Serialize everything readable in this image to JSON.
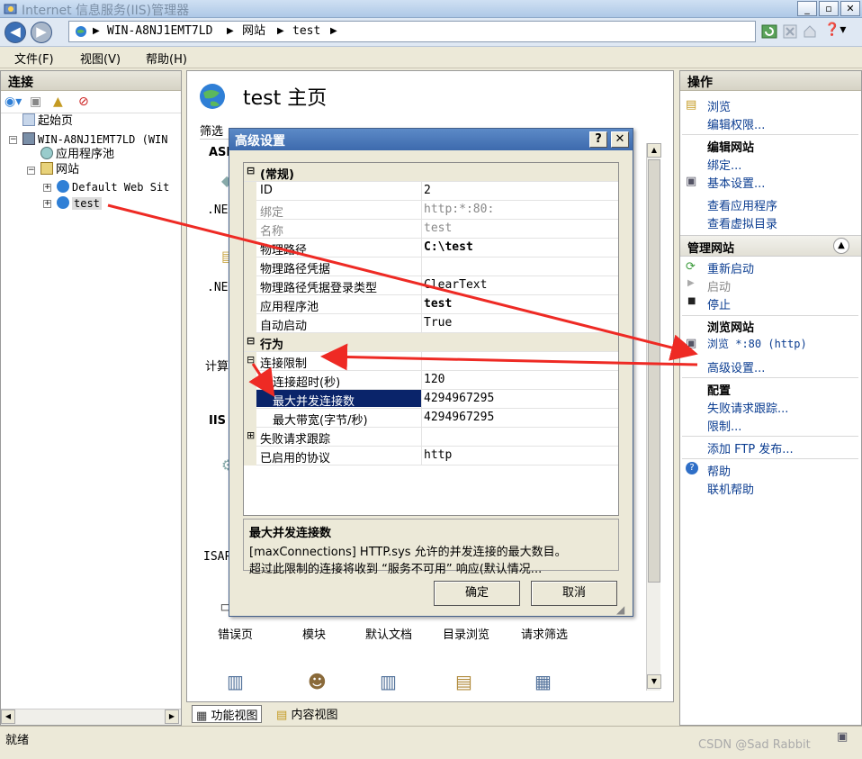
{
  "window": {
    "title": "Internet 信息服务(IIS)管理器"
  },
  "address": {
    "segments": [
      "WIN-A8NJ1EMT7LD",
      "网站",
      "test"
    ]
  },
  "menu": {
    "file": "文件(F)",
    "view": "视图(V)",
    "help": "帮助(H)"
  },
  "connections": {
    "title": "连接",
    "tree": {
      "start": "起始页",
      "server": "WIN-A8NJ1EMT7LD (WIN",
      "app_pools": "应用程序池",
      "sites": "网站",
      "default_site": "Default Web Sit",
      "test": "test"
    }
  },
  "center": {
    "page_title": "test 主页",
    "filter_label": "筛选",
    "group_aspnet": "ASP",
    "frag_net1": ".NE",
    "frag_net2": ".NE",
    "frag_calc": "计算",
    "group_iis": "IIS",
    "frag_isap": "ISAP",
    "features": [
      "错误页",
      "模块",
      "默认文档",
      "目录浏览",
      "请求筛选"
    ],
    "tab_features": "功能视图",
    "tab_content": "内容视图"
  },
  "dialog": {
    "title": "高级设置",
    "help_btn": "?",
    "close_btn": "✕",
    "cat_general": "(常规)",
    "rows_general": [
      {
        "k": "ID",
        "v": "2"
      },
      {
        "k": "绑定",
        "v": "http:*:80:"
      },
      {
        "k": "名称",
        "v": "test"
      },
      {
        "k": "物理路径",
        "v": "C:\\test"
      },
      {
        "k": "物理路径凭据",
        "v": ""
      },
      {
        "k": "物理路径凭据登录类型",
        "v": "ClearText"
      },
      {
        "k": "应用程序池",
        "v": "test"
      },
      {
        "k": "自动启动",
        "v": "True"
      }
    ],
    "cat_behavior": "行为",
    "limits": "连接限制",
    "rows_limits": [
      {
        "k": "连接超时(秒)",
        "v": "120"
      },
      {
        "k": "最大并发连接数",
        "v": "4294967295"
      },
      {
        "k": "最大带宽(字节/秒)",
        "v": "4294967295"
      }
    ],
    "failed_trace": "失败请求跟踪",
    "protocols": {
      "k": "已启用的协议",
      "v": "http"
    },
    "desc_title": "最大并发连接数",
    "desc_line1": "[maxConnections] HTTP.sys 允许的并发连接的最大数目。",
    "desc_line2": "超过此限制的连接将收到 “服务不可用” 响应(默认情况...",
    "ok": "确定",
    "cancel": "取消"
  },
  "actions": {
    "title": "操作",
    "browse": "浏览",
    "edit_perms": "编辑权限...",
    "edit_site": "编辑网站",
    "bindings": "绑定...",
    "basic": "基本设置...",
    "view_apps": "查看应用程序",
    "view_vdirs": "查看虚拟目录",
    "manage_site": "管理网站",
    "restart": "重新启动",
    "start": "启动",
    "stop": "停止",
    "browse_site": "浏览网站",
    "browse_80": "浏览 *:80 (http)",
    "advanced": "高级设置...",
    "config": "配置",
    "failed_req": "失败请求跟踪...",
    "limits": "限制...",
    "add_ftp": "添加 FTP 发布...",
    "help": "帮助",
    "online_help": "联机帮助"
  },
  "status": {
    "text": "就绪",
    "watermark": "CSDN @Sad Rabbit"
  },
  "colors": {
    "arrow": "#ee2a24",
    "selection": "#0a246a",
    "title_blue": "#3d6aad"
  }
}
